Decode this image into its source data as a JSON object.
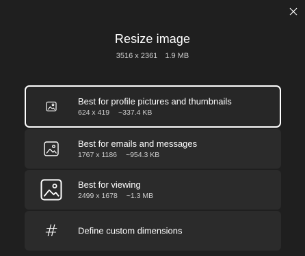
{
  "dialog": {
    "title": "Resize image",
    "original_dimensions": "3516 x 2361",
    "original_size": "1.9 MB"
  },
  "options": [
    {
      "label": "Best for profile pictures and thumbnails",
      "dimensions": "624 x 419",
      "size": "~337.4 KB",
      "icon": "image-small-icon",
      "selected": true
    },
    {
      "label": "Best for emails and messages",
      "dimensions": "1767 x 1186",
      "size": "~954.3 KB",
      "icon": "image-medium-icon",
      "selected": false
    },
    {
      "label": "Best for viewing",
      "dimensions": "2499 x 1678",
      "size": "~1.3 MB",
      "icon": "image-large-icon",
      "selected": false
    },
    {
      "label": "Define custom dimensions",
      "icon": "hash-icon",
      "symbol": "#",
      "selected": false
    }
  ],
  "colors": {
    "background": "#1f1f1f",
    "card": "#2b2b2b",
    "selected_border": "#ffffff",
    "text": "#ffffff",
    "subtext": "#cfcfcf"
  }
}
